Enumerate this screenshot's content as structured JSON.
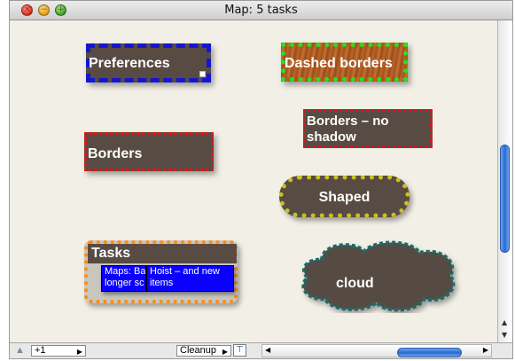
{
  "window": {
    "title": "Map: 5 tasks",
    "traffic": {
      "close": "×",
      "minimize": "−",
      "zoom": "+"
    }
  },
  "nodes": {
    "preferences": {
      "label": "Preferences"
    },
    "dashed_borders": {
      "label": "Dashed borders"
    },
    "borders_no_shadow": {
      "label_line1": "Borders – no",
      "label_line2": "shadow"
    },
    "borders": {
      "label": "Borders"
    },
    "shaped": {
      "label": "Shaped"
    },
    "tasks": {
      "label": "Tasks",
      "children": [
        {
          "line1": "Maps: Ba",
          "line2": "longer sc"
        },
        {
          "line1": "Hoist – and new",
          "line2": "items"
        }
      ]
    },
    "cloud": {
      "label": "cloud"
    }
  },
  "colors": {
    "node_fill": "#574b43",
    "blue_border": "#1616d0",
    "green_border": "#25e11e",
    "red_border": "#e01515",
    "yellow_border": "#c8c21a",
    "orange_border": "#ff8a12",
    "teal_border": "#1f6a6a",
    "task_child": "#0b00ff",
    "wood": "#a6531c"
  },
  "bottom_bar": {
    "zoom_value": "+1",
    "cleanup_label": "Cleanup",
    "icons": [
      "home-icon",
      "hoist-icon"
    ]
  }
}
